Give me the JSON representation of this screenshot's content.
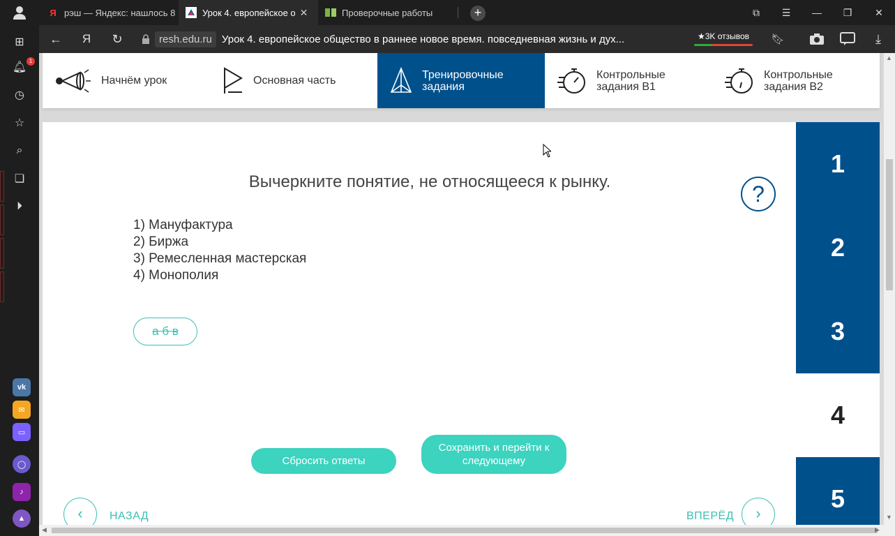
{
  "browser": {
    "tabs": [
      {
        "label": "рэш — Яндекс: нашлось 8",
        "favicon": "yandex-icon",
        "active": false
      },
      {
        "label": "Урок 4. европейское о",
        "favicon": "resh-icon",
        "active": true
      },
      {
        "label": "Проверочные работы",
        "favicon": "book-icon",
        "active": false
      }
    ],
    "new_tab_label": "+",
    "domain": "resh.edu.ru",
    "page_title": "Урок 4. европейское общество в раннее новое время. повседневная жизнь и дух...",
    "reviews": "★3K отзывов",
    "yandex_letter": "Я",
    "notification_count": "1"
  },
  "lesson_nav": [
    {
      "label": "Начнём урок",
      "icon": "megaphone-icon",
      "active": false
    },
    {
      "label": "Основная часть",
      "icon": "play-icon",
      "active": false
    },
    {
      "label": "Тренировочные задания",
      "icon": "pyramid-icon",
      "active": true
    },
    {
      "label": "Контрольные задания В1",
      "icon": "stopwatch-icon",
      "active": false
    },
    {
      "label": "Контрольные задания В2",
      "icon": "stopwatch-icon",
      "active": false
    }
  ],
  "task": {
    "question": "Вычеркните понятие, не относящееся к рынку.",
    "options": [
      "1) Мануфактура",
      "2) Биржа",
      "3) Ремесленная мастерская",
      "4) Монополия"
    ],
    "answer_chip": "а б в",
    "help_label": "?",
    "reset_label": "Сбросить ответы",
    "save_label": "Сохранить и перейти к следующему",
    "prev_label": "НАЗАД",
    "next_label": "ВПЕРЁД"
  },
  "question_numbers": [
    "1",
    "2",
    "3",
    "4",
    "5"
  ],
  "current_question": "4",
  "colors": {
    "brand_blue": "#00508c",
    "accent_teal": "#3cd3bf"
  }
}
